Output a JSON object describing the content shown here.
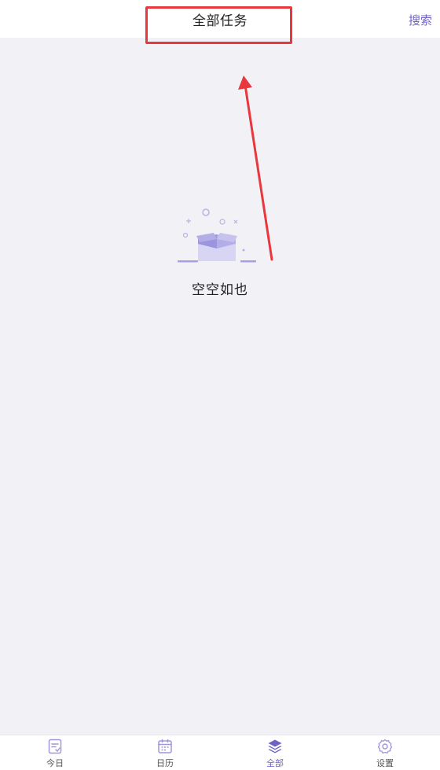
{
  "header": {
    "title": "全部任务",
    "search_label": "搜索"
  },
  "empty_state": {
    "text": "空空如也"
  },
  "tabbar": {
    "active_index": 2,
    "tabs": [
      {
        "label": "今日",
        "icon": "today-list-icon"
      },
      {
        "label": "日历",
        "icon": "calendar-icon"
      },
      {
        "label": "全部",
        "icon": "layers-icon"
      },
      {
        "label": "设置",
        "icon": "gear-icon"
      }
    ]
  },
  "colors": {
    "accent": "#6e63c4",
    "background": "#f1f1f6",
    "annotation": "#e8383d"
  }
}
